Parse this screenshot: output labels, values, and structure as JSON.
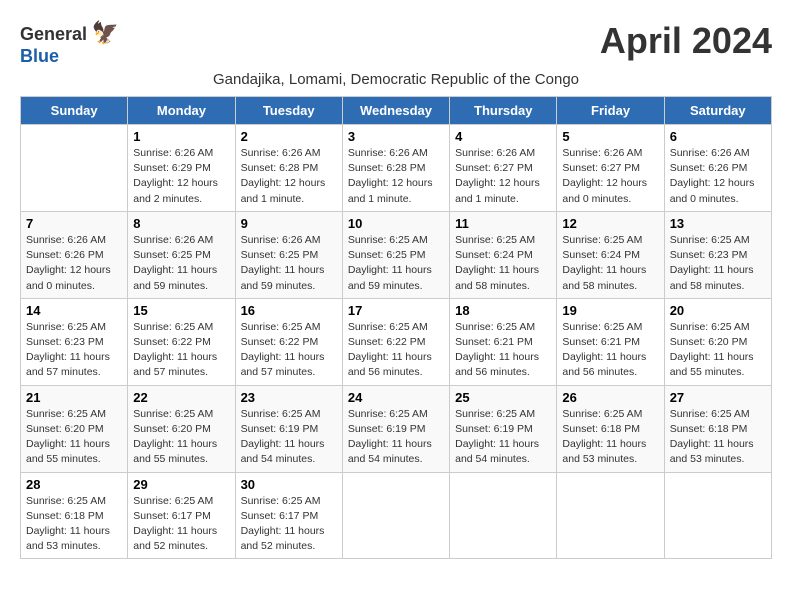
{
  "header": {
    "logo_general": "General",
    "logo_blue": "Blue",
    "month_title": "April 2024",
    "subtitle": "Gandajika, Lomami, Democratic Republic of the Congo"
  },
  "days_of_week": [
    "Sunday",
    "Monday",
    "Tuesday",
    "Wednesday",
    "Thursday",
    "Friday",
    "Saturday"
  ],
  "weeks": [
    [
      {
        "day": "",
        "info": ""
      },
      {
        "day": "1",
        "info": "Sunrise: 6:26 AM\nSunset: 6:29 PM\nDaylight: 12 hours\nand 2 minutes."
      },
      {
        "day": "2",
        "info": "Sunrise: 6:26 AM\nSunset: 6:28 PM\nDaylight: 12 hours\nand 1 minute."
      },
      {
        "day": "3",
        "info": "Sunrise: 6:26 AM\nSunset: 6:28 PM\nDaylight: 12 hours\nand 1 minute."
      },
      {
        "day": "4",
        "info": "Sunrise: 6:26 AM\nSunset: 6:27 PM\nDaylight: 12 hours\nand 1 minute."
      },
      {
        "day": "5",
        "info": "Sunrise: 6:26 AM\nSunset: 6:27 PM\nDaylight: 12 hours\nand 0 minutes."
      },
      {
        "day": "6",
        "info": "Sunrise: 6:26 AM\nSunset: 6:26 PM\nDaylight: 12 hours\nand 0 minutes."
      }
    ],
    [
      {
        "day": "7",
        "info": "Sunrise: 6:26 AM\nSunset: 6:26 PM\nDaylight: 12 hours\nand 0 minutes."
      },
      {
        "day": "8",
        "info": "Sunrise: 6:26 AM\nSunset: 6:25 PM\nDaylight: 11 hours\nand 59 minutes."
      },
      {
        "day": "9",
        "info": "Sunrise: 6:26 AM\nSunset: 6:25 PM\nDaylight: 11 hours\nand 59 minutes."
      },
      {
        "day": "10",
        "info": "Sunrise: 6:25 AM\nSunset: 6:25 PM\nDaylight: 11 hours\nand 59 minutes."
      },
      {
        "day": "11",
        "info": "Sunrise: 6:25 AM\nSunset: 6:24 PM\nDaylight: 11 hours\nand 58 minutes."
      },
      {
        "day": "12",
        "info": "Sunrise: 6:25 AM\nSunset: 6:24 PM\nDaylight: 11 hours\nand 58 minutes."
      },
      {
        "day": "13",
        "info": "Sunrise: 6:25 AM\nSunset: 6:23 PM\nDaylight: 11 hours\nand 58 minutes."
      }
    ],
    [
      {
        "day": "14",
        "info": "Sunrise: 6:25 AM\nSunset: 6:23 PM\nDaylight: 11 hours\nand 57 minutes."
      },
      {
        "day": "15",
        "info": "Sunrise: 6:25 AM\nSunset: 6:22 PM\nDaylight: 11 hours\nand 57 minutes."
      },
      {
        "day": "16",
        "info": "Sunrise: 6:25 AM\nSunset: 6:22 PM\nDaylight: 11 hours\nand 57 minutes."
      },
      {
        "day": "17",
        "info": "Sunrise: 6:25 AM\nSunset: 6:22 PM\nDaylight: 11 hours\nand 56 minutes."
      },
      {
        "day": "18",
        "info": "Sunrise: 6:25 AM\nSunset: 6:21 PM\nDaylight: 11 hours\nand 56 minutes."
      },
      {
        "day": "19",
        "info": "Sunrise: 6:25 AM\nSunset: 6:21 PM\nDaylight: 11 hours\nand 56 minutes."
      },
      {
        "day": "20",
        "info": "Sunrise: 6:25 AM\nSunset: 6:20 PM\nDaylight: 11 hours\nand 55 minutes."
      }
    ],
    [
      {
        "day": "21",
        "info": "Sunrise: 6:25 AM\nSunset: 6:20 PM\nDaylight: 11 hours\nand 55 minutes."
      },
      {
        "day": "22",
        "info": "Sunrise: 6:25 AM\nSunset: 6:20 PM\nDaylight: 11 hours\nand 55 minutes."
      },
      {
        "day": "23",
        "info": "Sunrise: 6:25 AM\nSunset: 6:19 PM\nDaylight: 11 hours\nand 54 minutes."
      },
      {
        "day": "24",
        "info": "Sunrise: 6:25 AM\nSunset: 6:19 PM\nDaylight: 11 hours\nand 54 minutes."
      },
      {
        "day": "25",
        "info": "Sunrise: 6:25 AM\nSunset: 6:19 PM\nDaylight: 11 hours\nand 54 minutes."
      },
      {
        "day": "26",
        "info": "Sunrise: 6:25 AM\nSunset: 6:18 PM\nDaylight: 11 hours\nand 53 minutes."
      },
      {
        "day": "27",
        "info": "Sunrise: 6:25 AM\nSunset: 6:18 PM\nDaylight: 11 hours\nand 53 minutes."
      }
    ],
    [
      {
        "day": "28",
        "info": "Sunrise: 6:25 AM\nSunset: 6:18 PM\nDaylight: 11 hours\nand 53 minutes."
      },
      {
        "day": "29",
        "info": "Sunrise: 6:25 AM\nSunset: 6:17 PM\nDaylight: 11 hours\nand 52 minutes."
      },
      {
        "day": "30",
        "info": "Sunrise: 6:25 AM\nSunset: 6:17 PM\nDaylight: 11 hours\nand 52 minutes."
      },
      {
        "day": "",
        "info": ""
      },
      {
        "day": "",
        "info": ""
      },
      {
        "day": "",
        "info": ""
      },
      {
        "day": "",
        "info": ""
      }
    ]
  ]
}
